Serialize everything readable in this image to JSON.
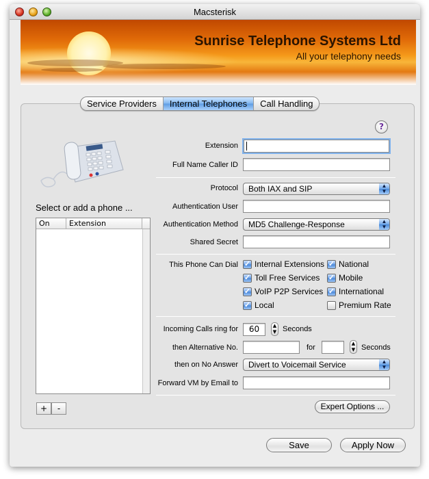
{
  "window": {
    "title": "Macsterisk"
  },
  "banner": {
    "company": "Sunrise Telephone Systems Ltd",
    "tagline": "All your telephony needs"
  },
  "tabs": [
    {
      "label": "Service Providers",
      "selected": false
    },
    {
      "label": "Internal Telephones",
      "selected": true
    },
    {
      "label": "Call Handling",
      "selected": false
    }
  ],
  "help": {
    "label": "?"
  },
  "phones": {
    "select_label": "Select or add a phone ...",
    "columns": [
      "On",
      "Extension"
    ],
    "rows": [],
    "add_label": "+",
    "remove_label": "-"
  },
  "form": {
    "extension": {
      "label": "Extension",
      "value": ""
    },
    "full_name": {
      "label": "Full Name Caller ID",
      "value": ""
    },
    "protocol": {
      "label": "Protocol",
      "value": "Both IAX and SIP"
    },
    "auth_user": {
      "label": "Authentication User",
      "value": ""
    },
    "auth_method": {
      "label": "Authentication Method",
      "value": "MD5 Challenge-Response"
    },
    "shared_secret": {
      "label": "Shared Secret",
      "value": ""
    },
    "dial": {
      "label": "This Phone Can Dial",
      "options": [
        {
          "label": "Internal Extensions",
          "checked": true
        },
        {
          "label": "National",
          "checked": true
        },
        {
          "label": "Toll Free Services",
          "checked": true
        },
        {
          "label": "Mobile",
          "checked": true
        },
        {
          "label": "VoIP P2P Services",
          "checked": true
        },
        {
          "label": "International",
          "checked": true
        },
        {
          "label": "Local",
          "checked": true
        },
        {
          "label": "Premium Rate",
          "checked": false
        }
      ]
    },
    "ring": {
      "label": "Incoming Calls ring for",
      "value": "60",
      "unit": "Seconds"
    },
    "alternative": {
      "label": "then Alternative No.",
      "value": "",
      "for_label": "for",
      "for_value": "",
      "unit": "Seconds"
    },
    "no_answer": {
      "label": "then on No Answer",
      "value": "Divert to Voicemail Service"
    },
    "forward_vm": {
      "label": "Forward VM by Email to",
      "value": ""
    }
  },
  "buttons": {
    "expert": "Expert Options ...",
    "save": "Save",
    "apply": "Apply Now"
  },
  "colors": {
    "accent": "#5d9be2",
    "banner_orange": "#e06a08"
  }
}
